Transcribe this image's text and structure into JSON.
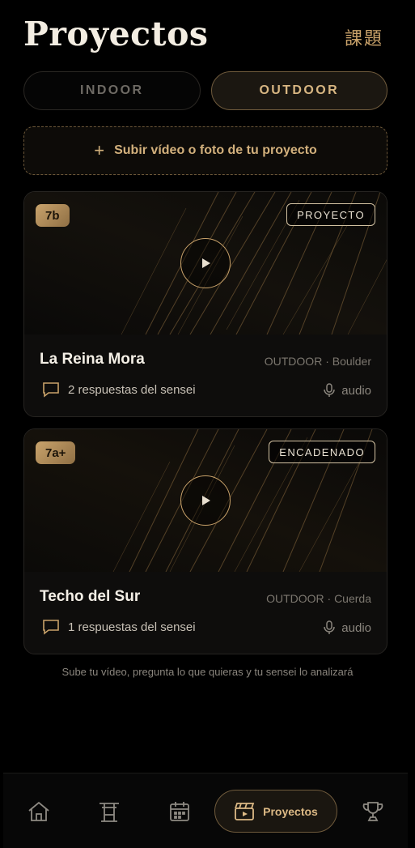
{
  "header": {
    "title": "Proyectos",
    "kanji": "課題"
  },
  "tabs": [
    {
      "label": "INDOOR",
      "active": false
    },
    {
      "label": "OUTDOOR",
      "active": true
    }
  ],
  "upload": {
    "label": "Subir vídeo o foto de tu proyecto",
    "icon": "plus-icon"
  },
  "projects": [
    {
      "grade": "7b",
      "status": "PROYECTO",
      "title": "La Reina Mora",
      "meta": "OUTDOOR · Boulder",
      "responses": "2 respuestas del sensei",
      "audio": "audio"
    },
    {
      "grade": "7a+",
      "status": "ENCADENADO",
      "title": "Techo del Sur",
      "meta": "OUTDOOR · Cuerda",
      "responses": "1 respuestas del sensei",
      "audio": "audio"
    }
  ],
  "footer_note": "Sube tu vídeo, pregunta lo que quieras y tu sensei lo analizará",
  "nav": {
    "items": [
      {
        "icon": "home-icon",
        "active": false
      },
      {
        "icon": "torii-icon",
        "active": false
      },
      {
        "icon": "calendar-icon",
        "active": false
      },
      {
        "icon": "clapperboard-icon",
        "label": "Proyectos",
        "active": true
      },
      {
        "icon": "trophy-icon",
        "active": false
      }
    ]
  },
  "colors": {
    "accent": "#c9a26a",
    "background": "#000000",
    "card": "#0e0d0c"
  }
}
